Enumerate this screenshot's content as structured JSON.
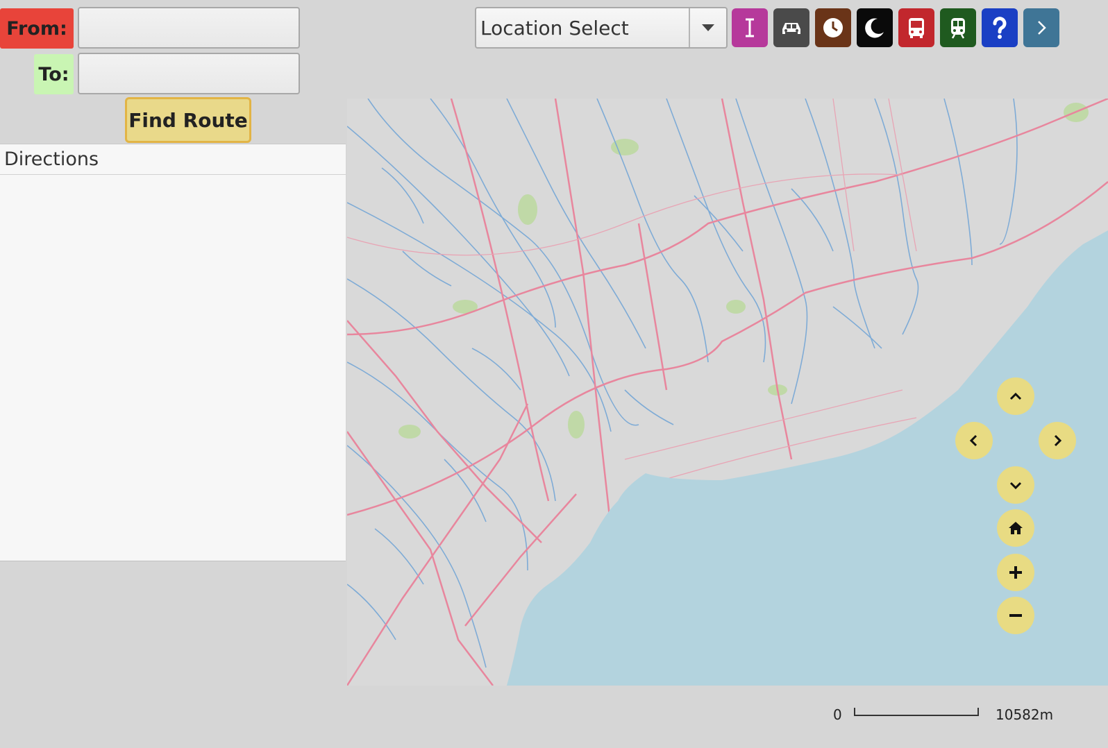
{
  "route": {
    "from_label": "From:",
    "to_label": "To:",
    "from_value": "",
    "to_value": "",
    "find_route_label": "Find Route"
  },
  "directions": {
    "header": "Directions"
  },
  "toolbar": {
    "location_select": "Location Select",
    "buttons": [
      {
        "icon": "text-cursor-icon",
        "color": "#b6399b"
      },
      {
        "icon": "car-icon",
        "color": "#4a4a4a"
      },
      {
        "icon": "clock-icon",
        "color": "#6a3418"
      },
      {
        "icon": "moon-icon",
        "color": "#0a0a0a"
      },
      {
        "icon": "bus-icon",
        "color": "#c2272d"
      },
      {
        "icon": "train-icon",
        "color": "#1f5a1f"
      },
      {
        "icon": "help-icon",
        "color": "#1a3fc4"
      },
      {
        "icon": "chevron-right-icon",
        "color": "#3f7596"
      }
    ]
  },
  "map": {
    "water_color": "#b3d3de",
    "land_color": "#d9d9d9",
    "road_color": "#e8869d",
    "river_color": "#7aa9d6",
    "park_color": "#b9d89a"
  },
  "nav_controls": {
    "color": "#e8db83",
    "icons": [
      "pan-up-icon",
      "pan-left-icon",
      "pan-right-icon",
      "pan-down-icon",
      "home-icon",
      "zoom-in-icon",
      "zoom-out-icon"
    ]
  },
  "scale": {
    "start": "0",
    "end": "10582m"
  }
}
